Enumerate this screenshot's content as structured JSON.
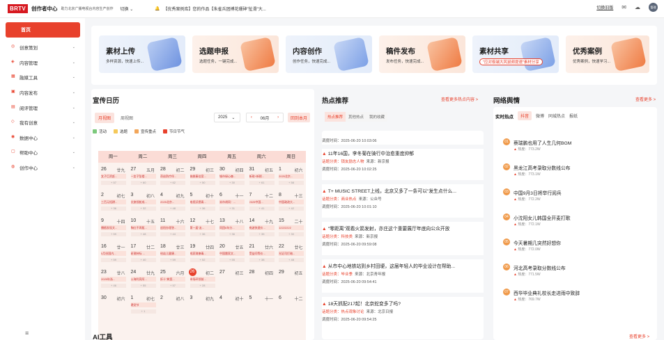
{
  "topbar": {
    "logo": "BRTV",
    "brand": "创作者中心",
    "slogan": "助力北京广播电视台内容生产创作",
    "switch_label": "切换",
    "notice": "【优秀案例库】您的作品【朱雀兵团搏花珊砷\"扯滑\"大...",
    "old_version": "切换旧版",
    "avatar_text": "管理"
  },
  "sidebar": {
    "home": "首页",
    "items": [
      "创意策划",
      "内容管理",
      "融媒工具",
      "内容发布",
      "阅评管理",
      "我有创意",
      "数据中心",
      "帮助中心",
      "创作中心"
    ]
  },
  "cards": [
    {
      "title": "素材上传",
      "desc": "多样资源，快速上传..."
    },
    {
      "title": "选题申报",
      "desc": "选题任务，一键完成..."
    },
    {
      "title": "内容创作",
      "desc": "创作任务，快速完成..."
    },
    {
      "title": "稿件发布",
      "desc": "发布任务，快速完成..."
    },
    {
      "title": "素材共享",
      "tag": "\"应对极端大风鼠频提速\"素材分享"
    },
    {
      "title": "优秀案例",
      "desc": "优秀案例，快速学习..."
    }
  ],
  "calendar": {
    "title": "宣传日历",
    "tab_month": "月视图",
    "tab_week": "周视图",
    "year": "2025",
    "month": "06月",
    "back_label": "回到本月",
    "legend": [
      "活动",
      "选题",
      "宣传重点",
      "节日节气"
    ],
    "weekdays": [
      "周一",
      "周二",
      "周三",
      "周四",
      "周五",
      "周六",
      "周日"
    ],
    "weeks": [
      [
        {
          "d": "26",
          "l": "廿九",
          "e": "女子巨资赶...",
          "c": "+ 57"
        },
        {
          "d": "27",
          "l": "五月",
          "e": "一女子坠楼...",
          "c": "+ 60"
        },
        {
          "d": "28",
          "l": "初二",
          "e": "奇幼防疗伴...",
          "c": "+ 62"
        },
        {
          "d": "29",
          "l": "初三",
          "e": "施救秦佳案...",
          "c": "+ 50"
        },
        {
          "d": "30",
          "l": "初四",
          "e": "城市绿心森...",
          "c": "+ 30"
        },
        {
          "d": "31",
          "l": "初五",
          "e": "新政+新税...",
          "c": "+ 61"
        },
        {
          "d": "1",
          "l": "初六",
          "e": "2025北京...",
          "c": "+ 58"
        }
      ],
      [
        {
          "d": "2",
          "l": "初七",
          "e": "三百元短耕...",
          "c": "+ 36"
        },
        {
          "d": "3",
          "l": "初八",
          "e": "文旅领航成...",
          "c": "+ 32"
        },
        {
          "d": "4",
          "l": "初九",
          "e": "2025北京...",
          "c": "+ 48"
        },
        {
          "d": "5",
          "l": "初十",
          "e": "电视沃德青...",
          "c": "+ 36"
        },
        {
          "d": "6",
          "l": "十一",
          "e": "米市胡同：...",
          "c": "+ 31"
        },
        {
          "d": "7",
          "l": "十二",
          "e": "2025中国...",
          "c": "+ 41"
        },
        {
          "d": "8",
          "l": "十三",
          "e": "中国政改大...",
          "c": "+ 42"
        }
      ],
      [
        {
          "d": "9",
          "l": "十四",
          "e": "播植发现文...",
          "c": "+ 59"
        },
        {
          "d": "10",
          "l": "十五",
          "e": "胸红不再甄...",
          "c": "+ 48"
        },
        {
          "d": "11",
          "l": "十六",
          "e": "追阳办理答...",
          "c": "+ 44"
        },
        {
          "d": "12",
          "l": "十七",
          "e": "第一届\"友...",
          "c": "+ 36"
        },
        {
          "d": "13",
          "l": "十八",
          "e": "同团6年分...",
          "c": "+ 36"
        },
        {
          "d": "14",
          "l": "十九",
          "e": "痴波快速价...",
          "c": "+ 35"
        },
        {
          "d": "15",
          "l": "二十",
          "e": "12222222",
          "c": "+ 30"
        }
      ],
      [
        {
          "d": "16",
          "l": "廿一",
          "e": "5月份国内...",
          "c": "+ 59"
        },
        {
          "d": "17",
          "l": "廿二",
          "e": "研潮持标 ...",
          "c": "+ 40"
        },
        {
          "d": "18",
          "l": "廿三",
          "e": "给幼儿健康...",
          "c": "+ 59"
        },
        {
          "d": "19",
          "l": "廿四",
          "e": "成家珠僚毒...",
          "c": "+ 52"
        },
        {
          "d": "20",
          "l": "廿五",
          "e": "中国雷家文...",
          "c": "+ 55"
        },
        {
          "d": "21",
          "l": "廿六",
          "e": "受益问等价...",
          "c": "+ 38"
        },
        {
          "d": "22",
          "l": "廿七",
          "e": "光证司打暗...",
          "c": "+ 48"
        }
      ],
      [
        {
          "d": "23",
          "l": "廿八",
          "e": "2025年浙...",
          "c": "+ 46"
        },
        {
          "d": "24",
          "l": "廿九",
          "e": "公海利亮阿...",
          "c": "+ 55"
        },
        {
          "d": "25",
          "l": "六月",
          "e": "折十\"典宽...",
          "c": "+ 57"
        },
        {
          "d": "26",
          "l": "初二",
          "e": "市场环领前...",
          "c": "+ 28",
          "today": true
        },
        {
          "d": "27",
          "l": "初三",
          "e": "",
          "c": ""
        },
        {
          "d": "28",
          "l": "初四",
          "e": "",
          "c": ""
        },
        {
          "d": "29",
          "l": "初五",
          "e": "",
          "c": ""
        }
      ],
      [
        {
          "d": "30",
          "l": "初六",
          "e": "",
          "c": ""
        },
        {
          "d": "1",
          "l": "初七",
          "e": "建党节",
          "c": "+ 1"
        },
        {
          "d": "2",
          "l": "初八",
          "e": "",
          "c": ""
        },
        {
          "d": "3",
          "l": "初九",
          "e": "",
          "c": ""
        },
        {
          "d": "4",
          "l": "初十",
          "e": "",
          "c": ""
        },
        {
          "d": "5",
          "l": "十一",
          "e": "",
          "c": ""
        },
        {
          "d": "6",
          "l": "十二",
          "e": "",
          "c": ""
        }
      ]
    ]
  },
  "hot": {
    "title": "热点推荐",
    "more": "查看更多热点内容 >",
    "tabs": [
      "热点推荐",
      "其他热点",
      "我的收藏"
    ],
    "top_time": "调度时间：2025-06-20 10:03:06",
    "items": [
      {
        "title": "11年16国，李冬菊在骑行中治愈重度抑郁",
        "cat": "话题分类：锁友励志人物",
        "src": "来源：新京报",
        "time": "调度时间：2025-06-20 10:02:25"
      },
      {
        "title": "T+ MUSIC STREET上线，北京又多了一条可以\"发生点什么...",
        "cat": "话题分类：商业热点",
        "src": "来源：公众号",
        "time": "调度时间：2025-06-20 10:01:10"
      },
      {
        "title": "\"零距离\"观看火箭发射，亦庄这个重要展厅年底向公众开放",
        "cat": "话题分类：科技类",
        "src": "来源：新京报",
        "time": "调度时间：2025-06-20 09:59:08"
      },
      {
        "title": "从市中心地铁站到乡村田埂，这届年轻人的毕业设计在帮助...",
        "cat": "话题分类：毕业季",
        "src": "来源：北京青年报",
        "time": "调度时间：2025-06-20 09:54:41"
      },
      {
        "title": "18天抓配217起！北京蛇变多了吗?",
        "cat": "话题分类：热点观象讨论",
        "src": "来源：北京日报",
        "time": "调度时间：2025-06-20 09:54:25"
      }
    ]
  },
  "opinion": {
    "title": "网络舆情",
    "more": "查看更多 >",
    "label": "实时热点",
    "tabs": [
      "抖音",
      "微博",
      "同城热点",
      "报纸"
    ],
    "items": [
      {
        "n": "01",
        "title": "蔡瑞鹏也用了人生几何BGM",
        "heat": "热度：773.2W"
      },
      {
        "n": "02",
        "title": "黑龙江高考录取分数线公布",
        "heat": "热度：773.1W"
      },
      {
        "n": "03",
        "title": "中国9月3日将举行阅兵",
        "heat": "热度：772.2W"
      },
      {
        "n": "04",
        "title": "小沈阳女儿韩国全开麦打歌",
        "heat": "热度：772.1W"
      },
      {
        "n": "05",
        "title": "今天暑期几突然好想你",
        "heat": "热度：772.0W"
      },
      {
        "n": "06",
        "title": "河北高考录取分数线公布",
        "heat": "热度：771.5W"
      },
      {
        "n": "07",
        "title": "西华毕业典礼校长走进雨中致辞",
        "heat": "热度：769.7W"
      }
    ]
  },
  "ai": {
    "title": "AI工具",
    "more": "查看更多 >"
  },
  "colors": {
    "accent": "#e8412c",
    "sidebar_bg": "#ffffff",
    "page_bg": "#f5f6f8"
  }
}
